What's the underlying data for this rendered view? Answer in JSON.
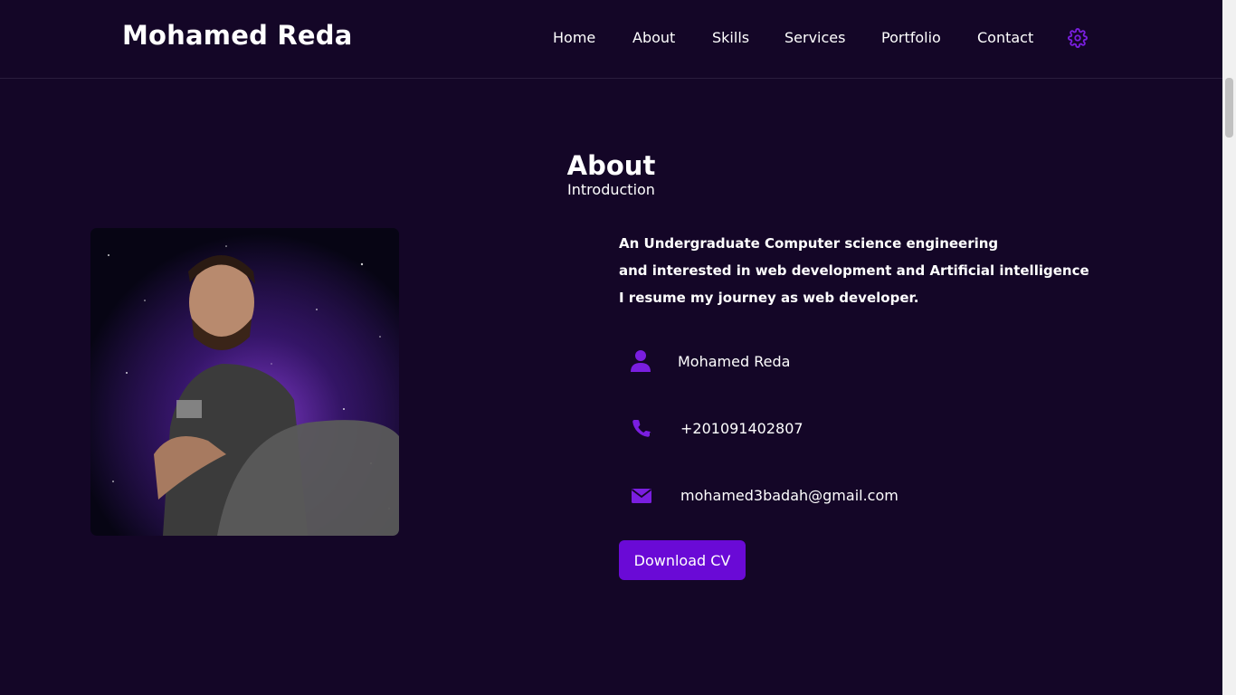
{
  "header": {
    "logo": "Mohamed Reda",
    "nav": {
      "home": "Home",
      "about": "About",
      "skills": "Skills",
      "services": "Services",
      "portfolio": "Portfolio",
      "contact": "Contact"
    },
    "theme_icon": "gear-icon"
  },
  "about": {
    "title": "About",
    "subtitle": "Introduction",
    "description": [
      "An Undergraduate Computer science engineering",
      "and interested in web development and Artificial intelligence",
      "I resume my journey as web developer."
    ],
    "info": {
      "name": "Mohamed Reda",
      "phone": "+201091402807",
      "email": "mohamed3badah@gmail.com"
    },
    "cv_button": "Download CV"
  },
  "colors": {
    "background": "#140627",
    "accent": "#6a0ad6",
    "icon": "#7a1ee0",
    "text": "#ffffff"
  }
}
